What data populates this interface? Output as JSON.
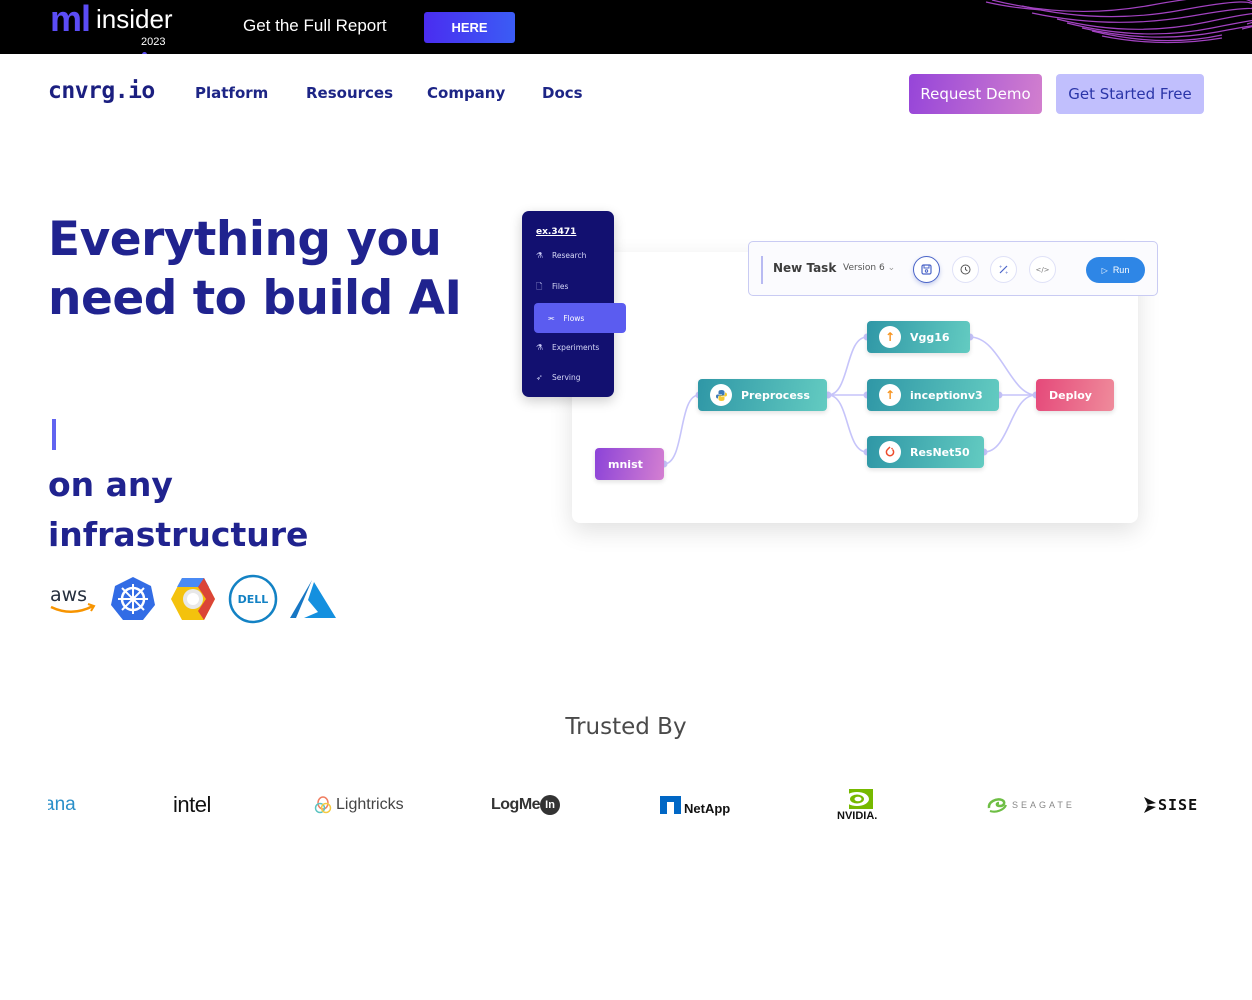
{
  "promo": {
    "logo_ml": "ml",
    "logo_insider": "insider",
    "logo_year": "2023",
    "text": "Get the Full Report",
    "button": "HERE"
  },
  "header": {
    "brand": "cnvrg.io",
    "nav": [
      "Platform",
      "Resources",
      "Company",
      "Docs"
    ],
    "request_demo": "Request Demo",
    "get_started": "Get Started Free"
  },
  "hero": {
    "title": "Everything you need to build AI",
    "subtitle": "on any infrastructure",
    "infra_logos": [
      "aws",
      "kubernetes",
      "google-cloud",
      "dell",
      "azure"
    ],
    "infra_logo_labels": {
      "aws": "aws",
      "dell": "DELL"
    }
  },
  "mock": {
    "project": "ex.3471",
    "sidebar": [
      {
        "label": "Research",
        "icon": "flask-icon"
      },
      {
        "label": "Files",
        "icon": "file-icon"
      },
      {
        "label": "Flows",
        "icon": "flow-icon",
        "active": true
      },
      {
        "label": "Experiments",
        "icon": "flask-icon"
      },
      {
        "label": "Serving",
        "icon": "rocket-icon"
      }
    ],
    "toolbar": {
      "task": "New Task",
      "version": "Version 6",
      "run": "Run"
    },
    "nodes": {
      "mnist": "mnist",
      "preprocess": "Preprocess",
      "vgg16": "Vgg16",
      "inceptionv3": "inceptionv3",
      "resnet50": "ResNet50",
      "deploy": "Deploy"
    }
  },
  "trusted": {
    "heading": "Trusted By",
    "logos": [
      "ana",
      "intel",
      "Lightricks",
      "LogMeIn",
      "NetApp",
      "NVIDIA",
      "SEAGATE",
      "SISENSE"
    ],
    "labels": {
      "ana": "ana",
      "intel": "intel",
      "lightricks": "Lightricks",
      "logmein": "LogMe",
      "logmein_in": "In",
      "netapp": "NetApp",
      "nvidia": "NVIDIA.",
      "seagate": "SEAGATE",
      "sisense": "SISE"
    }
  },
  "colors": {
    "brand_navy": "#20238f",
    "accent_purple": "#9645d9",
    "accent_lavender": "#c1bffd",
    "promo_blue": "#4a2df0",
    "flow_teal": "#63cbc1",
    "flow_pink": "#e5497a",
    "run_blue": "#2e86e6"
  }
}
